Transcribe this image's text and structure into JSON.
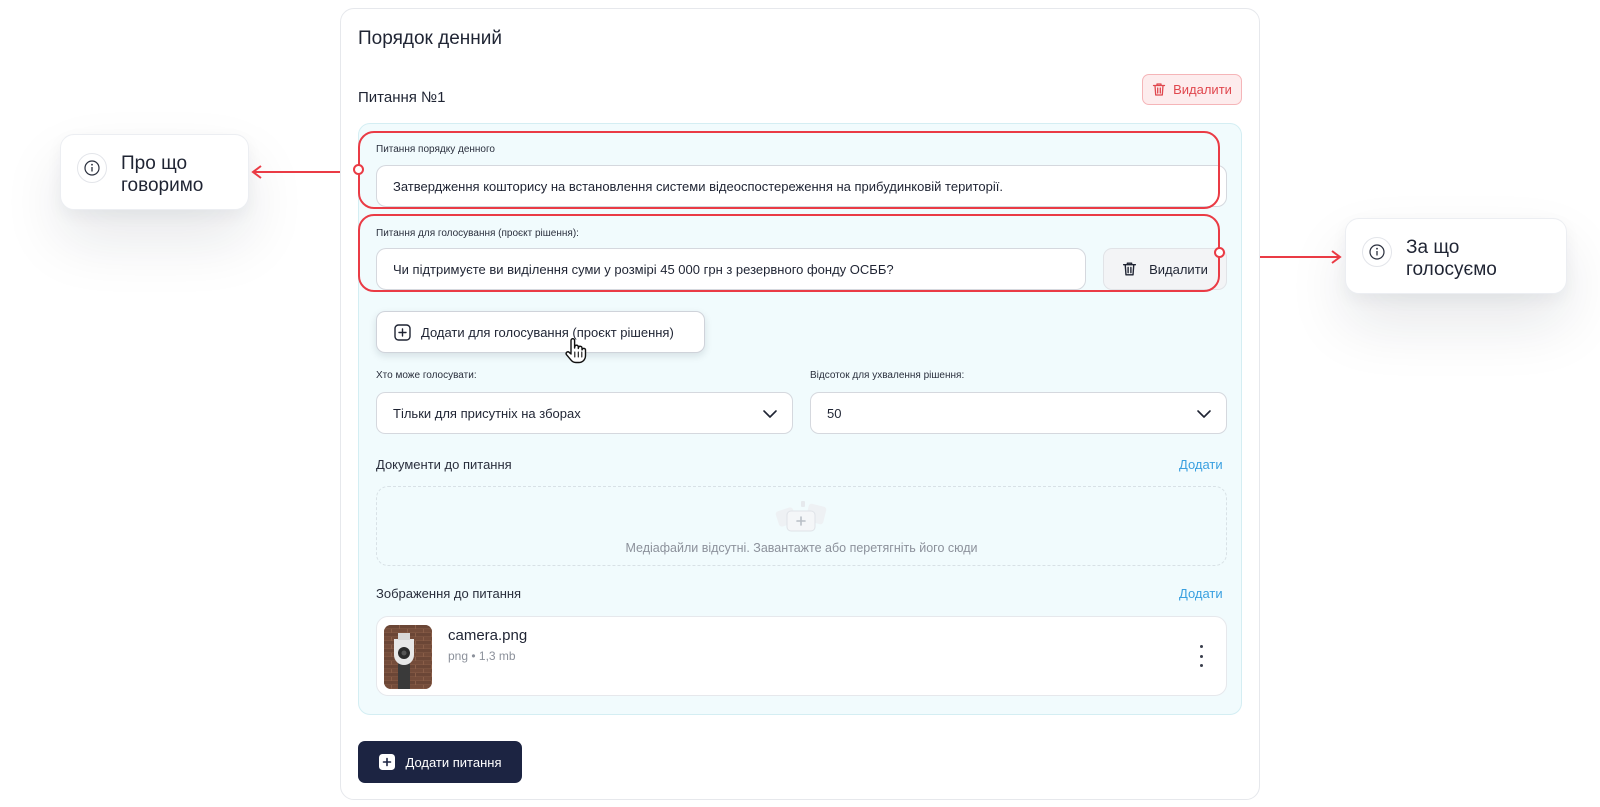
{
  "page": {
    "title": "Порядок денний"
  },
  "question": {
    "title": "Питання №1",
    "delete_label": "Видалити",
    "agenda_label": "Питання порядку денного",
    "agenda_value": "Затвердження кошторису на встановлення системи відеоспостереження на прибудинковій території.",
    "vote_label": "Питання для голосування (проєкт рішення):",
    "vote_value": "Чи підтримуєте ви виділення суми у розмірі 45 000 грн з резервного фонду ОСББ?",
    "vote_delete_label": "Видалити",
    "add_vote_label": "Додати для голосування (проєкт рішення)",
    "who_label": "Хто може голосувати:",
    "who_value": "Тільки для присутніх на зборах",
    "percent_label": "Відсоток для ухвалення рішення:",
    "percent_value": "50",
    "docs_label": "Документи до питання",
    "docs_add": "Додати",
    "dropzone_text": "Медіафайли відсутні. Завантажте або перетягніть його сюди",
    "images_label": "Зображення до питання",
    "images_add": "Додати",
    "file": {
      "name": "camera.png",
      "type": "png",
      "size": "1,3 mb"
    }
  },
  "add_question_label": "Додати питання",
  "callouts": {
    "left": "Про що говоримо",
    "right": "За що голосуємо"
  },
  "colors": {
    "accent_red": "#ea3b45",
    "primary_dark": "#1c2442",
    "link_blue": "#3aa0e0",
    "panel_bg": "#f1fbfd"
  }
}
